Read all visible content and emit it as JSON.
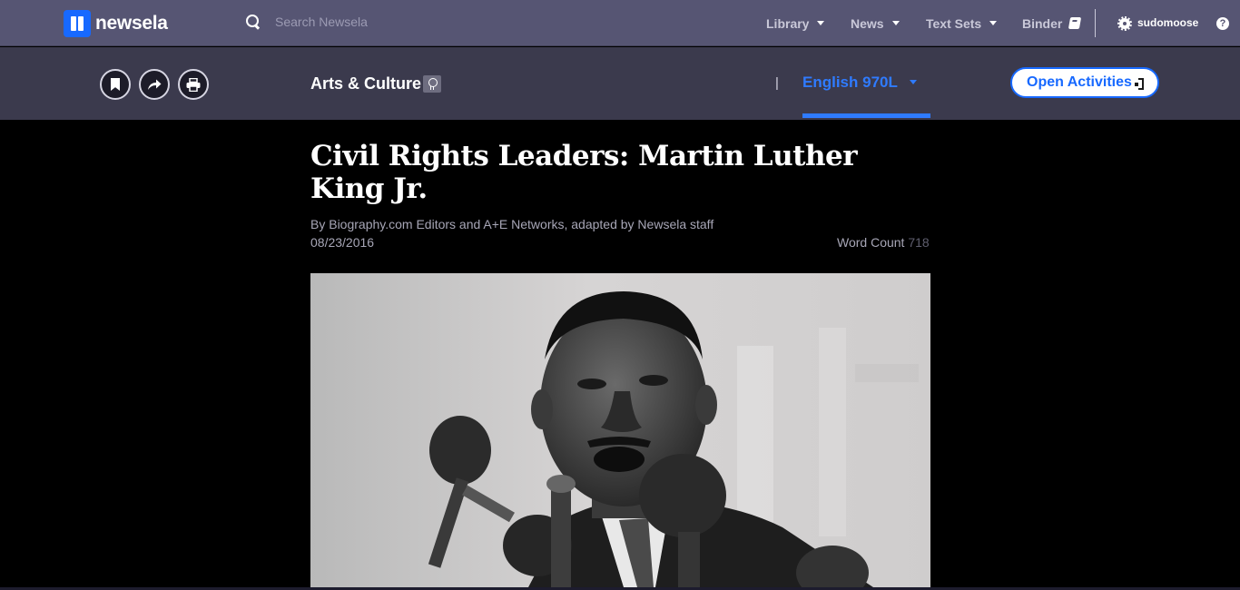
{
  "topbar": {
    "logo_text": "newsela",
    "search_placeholder": "Search Newsela",
    "menu": [
      "Library",
      "News",
      "Text Sets",
      "Binder"
    ],
    "username": "sudomoose",
    "help": "?"
  },
  "article_bar": {
    "section": "Arts & Culture",
    "separator": "|",
    "language_level": "English 970L",
    "open_activities": "Open Activities"
  },
  "article": {
    "title": "Civil Rights Leaders: Martin Luther King Jr.",
    "byline": "By Biography.com Editors and A+E Networks, adapted by Newsela staff",
    "date": "08/23/2016",
    "word_count_label": "Word Count",
    "word_count": "718"
  },
  "colors": {
    "topbar": "#565573",
    "subbar": "#3b3a4d",
    "accent": "#1769ff",
    "background": "#000000"
  }
}
